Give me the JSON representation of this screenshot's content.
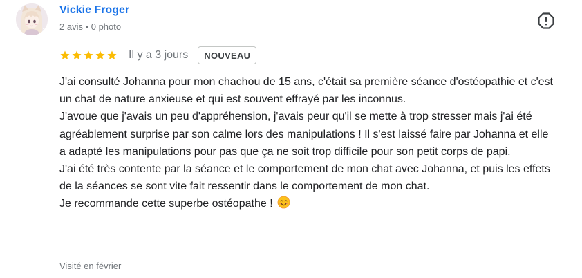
{
  "author": {
    "name": "Vickie Froger",
    "meta": "2 avis • 0 photo",
    "avatar_icon": "anime-girl-avatar"
  },
  "report_icon": "report-octagon-icon",
  "rating": {
    "stars": 5,
    "max_stars": 5,
    "star_color": "#fbbc04",
    "date": "Il y a 3 jours",
    "badge": "NOUVEAU"
  },
  "review": {
    "paragraphs": [
      "J'ai consulté Johanna pour mon chachou de 15 ans, c'était sa première séance d'ostéopathie et c'est un chat de nature anxieuse et qui est souvent effrayé par les inconnus.",
      "J'avoue que j'avais un peu d'appréhension, j'avais peur qu'il se mette à trop stresser mais j'ai été agréablement surprise par son calme lors des manipulations ! Il s'est laissé faire par Johanna et elle a adapté les manipulations pour pas que ça ne soit trop difficile pour son petit corps de papi.",
      "J'ai été très contente par la séance et le comportement de mon chat avec Johanna, et puis les effets de la séances se sont vite fait ressentir dans le comportement de mon chat.",
      "Je recommande cette superbe ostéopathe !"
    ],
    "emoji_icon": "smiling-face-emoji"
  },
  "visited": "Visité en février",
  "colors": {
    "author_link": "#1a73e8",
    "secondary_text": "#70757a",
    "body_text": "#202124"
  }
}
